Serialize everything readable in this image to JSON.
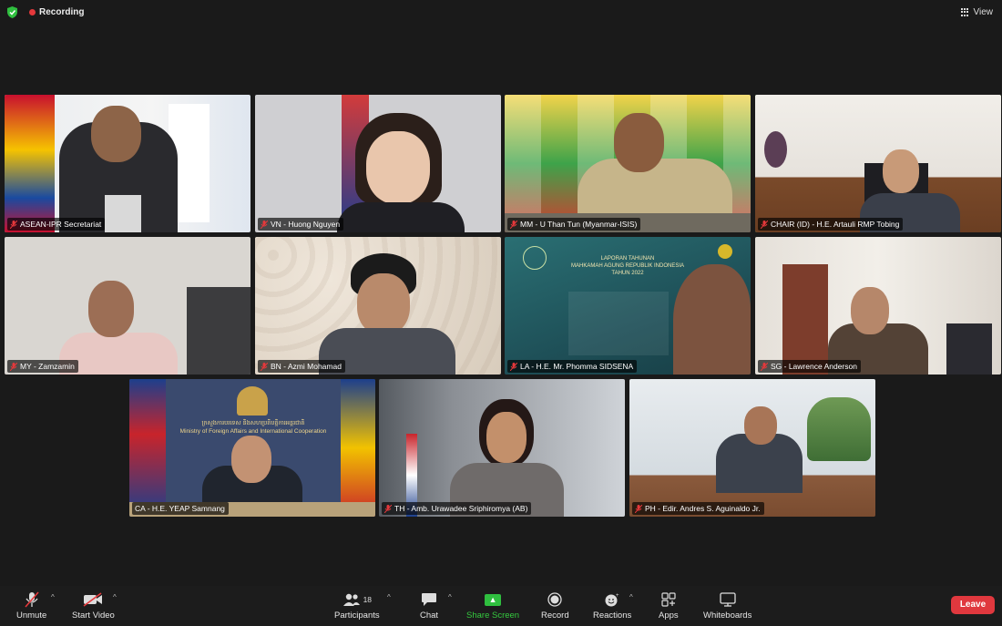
{
  "top": {
    "recording_label": "Recording",
    "view_label": "View"
  },
  "participants": [
    {
      "name": "ASEAN-IPR Secretariat"
    },
    {
      "name": "VN - Huong Nguyen"
    },
    {
      "name": "MM - U Than Tun (Myanmar-ISIS)"
    },
    {
      "name": "CHAIR (ID) - H.E. Artauli RMP Tobing",
      "active_speaker": true
    },
    {
      "name": "MY - Zamzamin"
    },
    {
      "name": "BN - Azmi Mohamad"
    },
    {
      "name": "LA - H.E. Mr. Phomma SIDSENA"
    },
    {
      "name": "SG - Lawrence Anderson"
    },
    {
      "name": "CA - H.E. YEAP Samnang"
    },
    {
      "name": "TH - Amb. Urawadee Sriphiromya (AB)"
    },
    {
      "name": "PH - Edir. Andres S. Aguinaldo Jr."
    }
  ],
  "backgrounds": {
    "ca_header": "ក្រសួងការបរទេស និងសហប្រតិបត្តិការអន្តរជាតិ",
    "ca_ministry": "Ministry of Foreign Affairs and International Cooperation",
    "la_title1": "LAPORAN TAHUNAN",
    "la_title2": "MAHKAMAH AGUNG REPUBLIK INDONESIA",
    "la_title3": "TAHUN 2022"
  },
  "toolbar": {
    "unmute": "Unmute",
    "start_video": "Start Video",
    "participants": "Participants",
    "participants_count": "18",
    "chat": "Chat",
    "share_screen": "Share Screen",
    "record": "Record",
    "reactions": "Reactions",
    "apps": "Apps",
    "whiteboards": "Whiteboards",
    "leave": "Leave"
  },
  "colors": {
    "accent_green": "#35c93f",
    "leave_red": "#e0383e",
    "active_outline": "#5dd25d"
  }
}
